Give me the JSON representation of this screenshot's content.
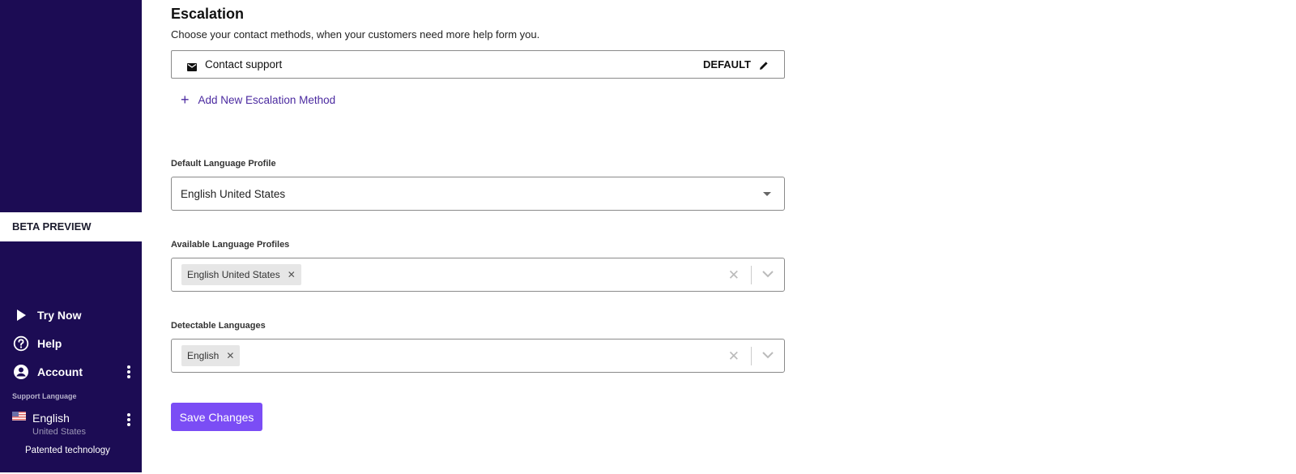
{
  "sidebar": {
    "beta_label": "BETA PREVIEW",
    "items": [
      {
        "label": "Try Now",
        "icon": "play-icon"
      },
      {
        "label": "Help",
        "icon": "help-circle-icon"
      },
      {
        "label": "Account",
        "icon": "account-circle-icon"
      }
    ],
    "support_language_label": "Support Language",
    "language": {
      "name": "English",
      "region": "United States",
      "flag": "us-flag-icon"
    },
    "footer": "Patented technology"
  },
  "escalation": {
    "title": "Escalation",
    "subtitle": "Choose your contact methods, when your customers need more help form you.",
    "methods": [
      {
        "label": "Contact support",
        "icon": "mail-icon",
        "badge": "DEFAULT"
      }
    ],
    "add_label": "Add New Escalation Method"
  },
  "default_language": {
    "label": "Default Language Profile",
    "value": "English United States"
  },
  "available_languages": {
    "label": "Available Language Profiles",
    "chips": [
      "English United States"
    ]
  },
  "detectable_languages": {
    "label": "Detectable Languages",
    "chips": [
      "English"
    ]
  },
  "save_label": "Save Changes",
  "colors": {
    "sidebar_bg": "#1c0c54",
    "accent": "#7b4df5",
    "link": "#4b2aa0"
  }
}
